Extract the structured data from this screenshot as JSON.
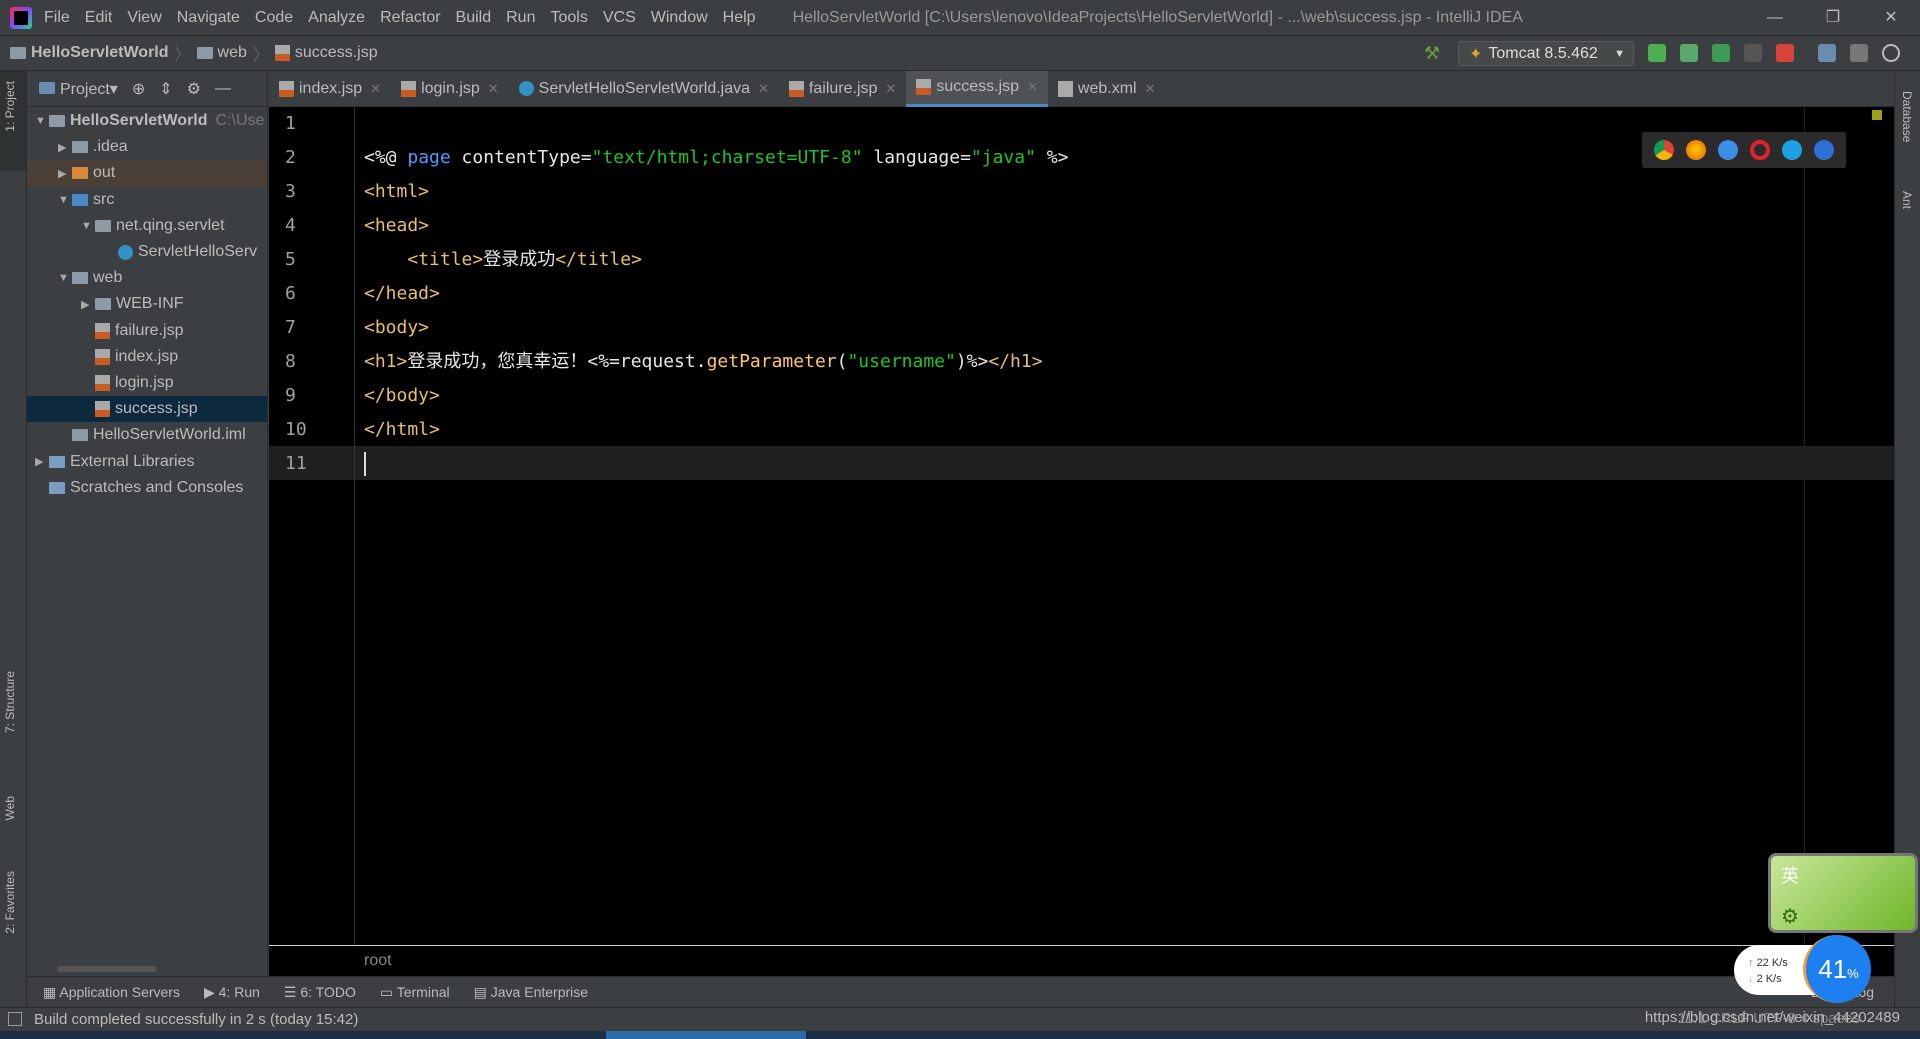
{
  "app": {
    "menu": [
      "File",
      "Edit",
      "View",
      "Navigate",
      "Code",
      "Analyze",
      "Refactor",
      "Build",
      "Run",
      "Tools",
      "VCS",
      "Window",
      "Help"
    ],
    "window_title": "HelloServletWorld [C:\\Users\\lenovo\\IdeaProjects\\HelloServletWorld] - ...\\web\\success.jsp - IntelliJ IDEA",
    "window_buttons": [
      "minimize",
      "restore",
      "close"
    ]
  },
  "breadcrumb": [
    "HelloServletWorld",
    "web",
    "success.jsp"
  ],
  "run_config": "Tomcat 8.5.462",
  "left_strip": [
    "1: Project",
    "7: Structure",
    "Web",
    "2: Favorites"
  ],
  "right_strip": [
    "Database",
    "Ant"
  ],
  "project_panel": {
    "title": "Project",
    "tree": [
      {
        "label": "HelloServletWorld",
        "hint": "C:\\Use",
        "depth": 0,
        "type": "module",
        "expanded": true
      },
      {
        "label": ".idea",
        "depth": 1,
        "type": "folder",
        "expanded": false
      },
      {
        "label": "out",
        "depth": 1,
        "type": "folder-orange",
        "expanded": false
      },
      {
        "label": "src",
        "depth": 1,
        "type": "folder-blue",
        "expanded": true
      },
      {
        "label": "net.qing.servlet",
        "depth": 2,
        "type": "package",
        "expanded": true
      },
      {
        "label": "ServletHelloServ",
        "depth": 3,
        "type": "class"
      },
      {
        "label": "web",
        "depth": 1,
        "type": "folder-web",
        "expanded": true
      },
      {
        "label": "WEB-INF",
        "depth": 2,
        "type": "folder",
        "expanded": false
      },
      {
        "label": "failure.jsp",
        "depth": 2,
        "type": "jsp"
      },
      {
        "label": "index.jsp",
        "depth": 2,
        "type": "jsp"
      },
      {
        "label": "login.jsp",
        "depth": 2,
        "type": "jsp"
      },
      {
        "label": "success.jsp",
        "depth": 2,
        "type": "jsp",
        "selected": true
      },
      {
        "label": "HelloServletWorld.iml",
        "depth": 1,
        "type": "iml"
      },
      {
        "label": "External Libraries",
        "depth": 0,
        "type": "lib",
        "expanded": false
      },
      {
        "label": "Scratches and Consoles",
        "depth": 0,
        "type": "scratch"
      }
    ]
  },
  "tabs": [
    {
      "label": "index.jsp",
      "type": "jsp"
    },
    {
      "label": "login.jsp",
      "type": "jsp"
    },
    {
      "label": "ServletHelloServletWorld.java",
      "type": "class"
    },
    {
      "label": "failure.jsp",
      "type": "jsp"
    },
    {
      "label": "success.jsp",
      "type": "jsp",
      "active": true
    },
    {
      "label": "web.xml",
      "type": "xml"
    }
  ],
  "editor": {
    "current_line": 11,
    "lines": [
      "",
      "<%@ page contentType=\"text/html;charset=UTF-8\" language=\"java\" %>",
      "<html>",
      "<head>",
      "    <title>登录成功</title>",
      "</head>",
      "<body>",
      "<h1>登录成功，您真幸运！<%=request.getParameter(\"username\")%></h1>",
      "</body>",
      "</html>",
      ""
    ],
    "breadcrumb": "root"
  },
  "tool_windows": [
    "Application Servers",
    "4: Run",
    "6: TODO",
    "Terminal",
    "Java Enterprise",
    "Event Log"
  ],
  "status": {
    "message": "Build completed successfully in 2 s (today 15:42)",
    "right": "11:1  CRLF  UTF-8  4 spaces",
    "watermark": "https://blog.csdn.net/weixin_44202489"
  },
  "overlay": {
    "ime": "英",
    "upload": "22  K/s",
    "download": "2   K/s",
    "percent": "41",
    "percent_sign": "%"
  }
}
